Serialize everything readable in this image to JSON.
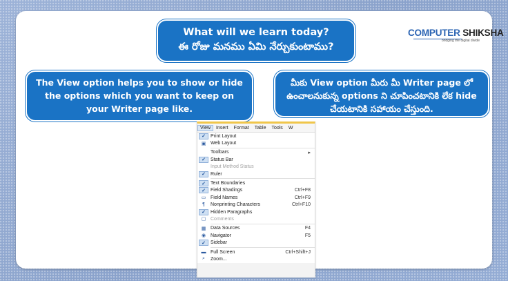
{
  "title": {
    "english": "What will we learn today?",
    "telugu": "ఈ రోజు మనము ఏమి నేర్చుకుంటాము?"
  },
  "logo": {
    "brand_part1": "COMPUTER",
    "brand_part2": "SHIKSHA",
    "tagline": "bridging the digital divide"
  },
  "left_text": "The View option helps you to show or hide the options which you want to keep on your Writer page like.",
  "right_text": "మీకు View option మీరు మీ Writer page లో ఉంచాలనుకున్న options ని చూపించటానికి లేక hide చేయటానికి సహాయం చేస్తుంది.",
  "menubar": [
    "View",
    "Insert",
    "Format",
    "Table",
    "Tools",
    "W"
  ],
  "menu_items": [
    {
      "label": "Print Layout",
      "shortcut": "",
      "icon": "print-layout-icon",
      "checked": true
    },
    {
      "label": "Web Layout",
      "shortcut": "",
      "icon": "web-layout-icon",
      "checked": false
    },
    {
      "sep": true
    },
    {
      "label": "Toolbars",
      "shortcut": "▸",
      "icon": "",
      "checked": false
    },
    {
      "label": "Status Bar",
      "shortcut": "",
      "icon": "",
      "checked": true
    },
    {
      "label": "Input Method Status",
      "shortcut": "",
      "icon": "",
      "checked": false,
      "disabled": true
    },
    {
      "label": "Ruler",
      "shortcut": "",
      "icon": "",
      "checked": true
    },
    {
      "sep": true
    },
    {
      "label": "Text Boundaries",
      "shortcut": "",
      "icon": "",
      "checked": true
    },
    {
      "label": "Field Shadings",
      "shortcut": "Ctrl+F8",
      "icon": "field-shadings-icon",
      "checked": true
    },
    {
      "label": "Field Names",
      "shortcut": "Ctrl+F9",
      "icon": "field-names-icon",
      "checked": false
    },
    {
      "label": "Nonprinting Characters",
      "shortcut": "Ctrl+F10",
      "icon": "pilcrow-icon",
      "checked": false
    },
    {
      "label": "Hidden Paragraphs",
      "shortcut": "",
      "icon": "",
      "checked": true
    },
    {
      "label": "Comments",
      "shortcut": "",
      "icon": "comments-icon",
      "checked": false,
      "disabled": true
    },
    {
      "sep": true
    },
    {
      "label": "Data Sources",
      "shortcut": "F4",
      "icon": "data-sources-icon",
      "checked": false
    },
    {
      "label": "Navigator",
      "shortcut": "F5",
      "icon": "navigator-icon",
      "checked": false
    },
    {
      "label": "Sidebar",
      "shortcut": "",
      "icon": "",
      "checked": true
    },
    {
      "sep": true
    },
    {
      "label": "Full Screen",
      "shortcut": "Ctrl+Shift+J",
      "icon": "full-screen-icon",
      "checked": false
    },
    {
      "label": "Zoom...",
      "shortcut": "",
      "icon": "zoom-icon",
      "checked": false
    }
  ]
}
